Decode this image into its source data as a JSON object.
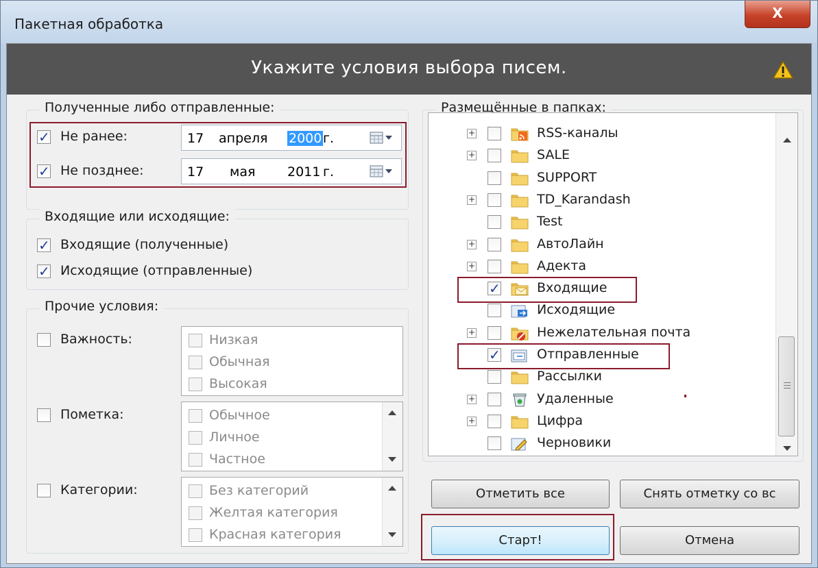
{
  "window": {
    "title": "Пакетная обработка",
    "close": "X"
  },
  "banner": {
    "text": "Укажите условия выбора писем."
  },
  "received_sent": {
    "caption": "Полученные либо отправленные:",
    "not_earlier": {
      "label": "Не ранее:",
      "day": "17",
      "month": "апреля",
      "year": "2000",
      "suffix": "г.",
      "checked": true
    },
    "not_later": {
      "label": "Не позднее:",
      "day": "17",
      "month": "мая",
      "year": "2011",
      "suffix": "г.",
      "checked": true
    }
  },
  "direction": {
    "caption": "Входящие или исходящие:",
    "incoming": "Входящие (полученные)",
    "outgoing": "Исходящие (отправленные)"
  },
  "other": {
    "caption": "Прочие условия:",
    "importance": {
      "label": "Важность:",
      "options": [
        "Низкая",
        "Обычная",
        "Высокая"
      ]
    },
    "flag": {
      "label": "Пометка:",
      "options": [
        "Обычное",
        "Личное",
        "Частное"
      ]
    },
    "categories": {
      "label": "Категории:",
      "options": [
        "Без категорий",
        "Желтая категория",
        "Красная категория"
      ]
    }
  },
  "folders": {
    "caption": "Размещённые в папках:",
    "items": [
      {
        "name": "RSS-каналы",
        "expandable": true,
        "checked": false,
        "icon": "rss-folder-icon"
      },
      {
        "name": "SALE",
        "expandable": true,
        "checked": false,
        "icon": "folder-icon"
      },
      {
        "name": "SUPPORT",
        "expandable": false,
        "checked": false,
        "icon": "folder-icon"
      },
      {
        "name": "TD_Karandash",
        "expandable": true,
        "checked": false,
        "icon": "folder-icon"
      },
      {
        "name": "Test",
        "expandable": false,
        "checked": false,
        "icon": "folder-icon"
      },
      {
        "name": "АвтоЛайн",
        "expandable": true,
        "checked": false,
        "icon": "folder-icon"
      },
      {
        "name": "Адекта",
        "expandable": true,
        "checked": false,
        "icon": "folder-icon"
      },
      {
        "name": "Входящие",
        "expandable": false,
        "checked": true,
        "icon": "inbox-icon"
      },
      {
        "name": "Исходящие",
        "expandable": false,
        "checked": false,
        "icon": "outbox-icon"
      },
      {
        "name": "Нежелательная почта",
        "expandable": true,
        "checked": false,
        "icon": "junk-icon"
      },
      {
        "name": "Отправленные",
        "expandable": false,
        "checked": true,
        "icon": "sent-icon"
      },
      {
        "name": "Рассылки",
        "expandable": false,
        "checked": false,
        "icon": "folder-icon"
      },
      {
        "name": "Удаленные",
        "expandable": true,
        "checked": false,
        "icon": "trash-icon"
      },
      {
        "name": "Цифра",
        "expandable": true,
        "checked": false,
        "icon": "folder-icon"
      },
      {
        "name": "Черновики",
        "expandable": false,
        "checked": false,
        "icon": "drafts-icon"
      }
    ]
  },
  "buttons": {
    "select_all": "Отметить все",
    "clear_all": "Снять отметку со вс",
    "start": "Старт!",
    "cancel": "Отмена"
  },
  "colors": {
    "banner": "#545454",
    "highlight_border": "#8b1a2c",
    "check": "#21409a",
    "selection": "#3399ff"
  }
}
